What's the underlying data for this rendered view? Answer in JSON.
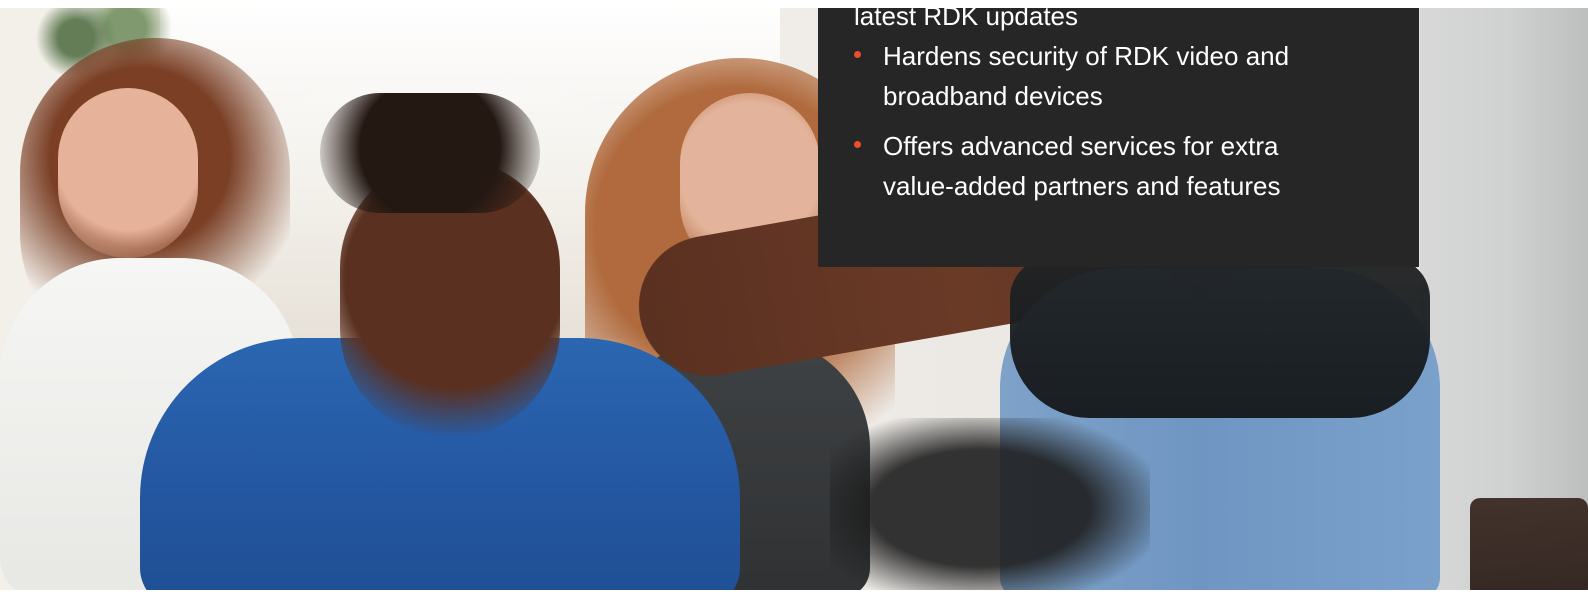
{
  "panel": {
    "partial_line": "latest RDK updates",
    "bullets": [
      {
        "line1": "Hardens security of RDK video and",
        "line2": "broadband devices"
      },
      {
        "line1": "Offers advanced services for extra",
        "line2": "value-added partners and features"
      }
    ],
    "bullet_color": "#ee4d2d",
    "background_color": "#262626",
    "text_color": "#ffffff"
  }
}
